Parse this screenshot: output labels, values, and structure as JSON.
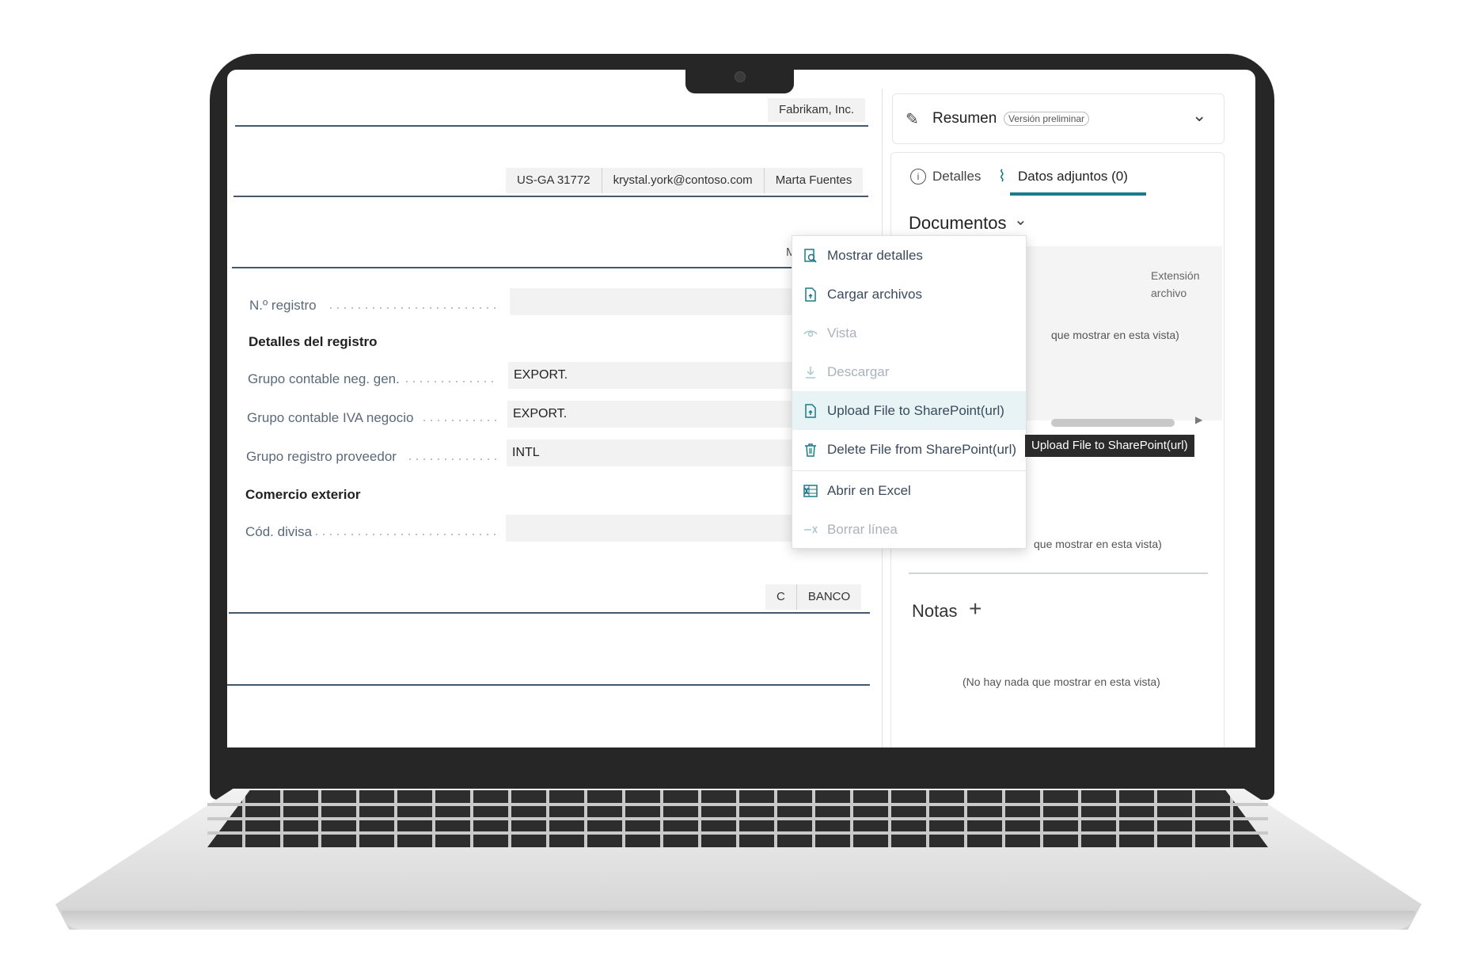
{
  "header": {
    "company": "Fabrikam, Inc.",
    "chips": [
      "US-GA 31772",
      "krystal.york@contoso.com",
      "Marta Fuentes"
    ],
    "partial_letter": "M"
  },
  "form": {
    "registro_label": "N.º registro",
    "registro_value": "",
    "section_detalles": "Detalles del registro",
    "fields": [
      {
        "label": "Grupo contable neg. gen.",
        "value": "EXPORT."
      },
      {
        "label": "Grupo contable IVA negocio",
        "value": "EXPORT."
      },
      {
        "label": "Grupo registro proveedor",
        "value": "INTL"
      }
    ],
    "section_comercio": "Comercio exterior",
    "divisa_label": "Cód. divisa",
    "divisa_value": ""
  },
  "bank_chips": [
    "C",
    "BANCO"
  ],
  "panel": {
    "resumen_title": "Resumen",
    "resumen_badge": "Versión preliminar",
    "tabs": [
      {
        "label": "Detalles",
        "icon": "info-icon"
      },
      {
        "label": "Datos adjuntos (0)",
        "icon": "paperclip-icon"
      }
    ],
    "documentos_title": "Documentos",
    "column_header": "Extensión archivo",
    "empty_text_1": "que mostrar en esta vista)",
    "empty_text_2": "que mostrar en esta vista)",
    "notas_title": "Notas",
    "notas_empty": "(No hay nada que mostrar en esta vista)"
  },
  "context_menu": {
    "items": [
      {
        "label": "Mostrar detalles",
        "icon": "search-document-icon",
        "enabled": true
      },
      {
        "label": "Cargar archivos",
        "icon": "upload-file-icon",
        "enabled": true
      },
      {
        "label": "Vista",
        "icon": "eye-icon",
        "enabled": false
      },
      {
        "label": "Descargar",
        "icon": "download-icon",
        "enabled": false
      },
      {
        "label": "Upload File to SharePoint(url)",
        "icon": "upload-file-icon",
        "enabled": true,
        "hovered": true
      },
      {
        "label": "Delete File from SharePoint(url)",
        "icon": "trash-icon",
        "enabled": true
      },
      {
        "label": "Abrir en Excel",
        "icon": "excel-icon",
        "enabled": true
      },
      {
        "label": "Borrar línea",
        "icon": "delete-row-icon",
        "enabled": false
      }
    ]
  },
  "tooltip": "Upload File to SharePoint(url)",
  "colors": {
    "accent": "#1b7a8c",
    "rule": "#46586e"
  }
}
